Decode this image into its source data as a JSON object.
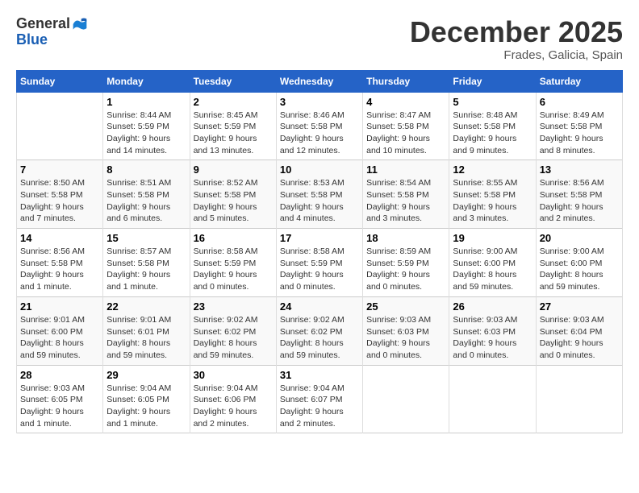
{
  "header": {
    "logo_general": "General",
    "logo_blue": "Blue",
    "month_title": "December 2025",
    "location": "Frades, Galicia, Spain"
  },
  "days_of_week": [
    "Sunday",
    "Monday",
    "Tuesday",
    "Wednesday",
    "Thursday",
    "Friday",
    "Saturday"
  ],
  "weeks": [
    [
      {
        "day": "",
        "info": ""
      },
      {
        "day": "1",
        "info": "Sunrise: 8:44 AM\nSunset: 5:59 PM\nDaylight: 9 hours\nand 14 minutes."
      },
      {
        "day": "2",
        "info": "Sunrise: 8:45 AM\nSunset: 5:59 PM\nDaylight: 9 hours\nand 13 minutes."
      },
      {
        "day": "3",
        "info": "Sunrise: 8:46 AM\nSunset: 5:58 PM\nDaylight: 9 hours\nand 12 minutes."
      },
      {
        "day": "4",
        "info": "Sunrise: 8:47 AM\nSunset: 5:58 PM\nDaylight: 9 hours\nand 10 minutes."
      },
      {
        "day": "5",
        "info": "Sunrise: 8:48 AM\nSunset: 5:58 PM\nDaylight: 9 hours\nand 9 minutes."
      },
      {
        "day": "6",
        "info": "Sunrise: 8:49 AM\nSunset: 5:58 PM\nDaylight: 9 hours\nand 8 minutes."
      }
    ],
    [
      {
        "day": "7",
        "info": "Sunrise: 8:50 AM\nSunset: 5:58 PM\nDaylight: 9 hours\nand 7 minutes."
      },
      {
        "day": "8",
        "info": "Sunrise: 8:51 AM\nSunset: 5:58 PM\nDaylight: 9 hours\nand 6 minutes."
      },
      {
        "day": "9",
        "info": "Sunrise: 8:52 AM\nSunset: 5:58 PM\nDaylight: 9 hours\nand 5 minutes."
      },
      {
        "day": "10",
        "info": "Sunrise: 8:53 AM\nSunset: 5:58 PM\nDaylight: 9 hours\nand 4 minutes."
      },
      {
        "day": "11",
        "info": "Sunrise: 8:54 AM\nSunset: 5:58 PM\nDaylight: 9 hours\nand 3 minutes."
      },
      {
        "day": "12",
        "info": "Sunrise: 8:55 AM\nSunset: 5:58 PM\nDaylight: 9 hours\nand 3 minutes."
      },
      {
        "day": "13",
        "info": "Sunrise: 8:56 AM\nSunset: 5:58 PM\nDaylight: 9 hours\nand 2 minutes."
      }
    ],
    [
      {
        "day": "14",
        "info": "Sunrise: 8:56 AM\nSunset: 5:58 PM\nDaylight: 9 hours\nand 1 minute."
      },
      {
        "day": "15",
        "info": "Sunrise: 8:57 AM\nSunset: 5:58 PM\nDaylight: 9 hours\nand 1 minute."
      },
      {
        "day": "16",
        "info": "Sunrise: 8:58 AM\nSunset: 5:59 PM\nDaylight: 9 hours\nand 0 minutes."
      },
      {
        "day": "17",
        "info": "Sunrise: 8:58 AM\nSunset: 5:59 PM\nDaylight: 9 hours\nand 0 minutes."
      },
      {
        "day": "18",
        "info": "Sunrise: 8:59 AM\nSunset: 5:59 PM\nDaylight: 9 hours\nand 0 minutes."
      },
      {
        "day": "19",
        "info": "Sunrise: 9:00 AM\nSunset: 6:00 PM\nDaylight: 8 hours\nand 59 minutes."
      },
      {
        "day": "20",
        "info": "Sunrise: 9:00 AM\nSunset: 6:00 PM\nDaylight: 8 hours\nand 59 minutes."
      }
    ],
    [
      {
        "day": "21",
        "info": "Sunrise: 9:01 AM\nSunset: 6:00 PM\nDaylight: 8 hours\nand 59 minutes."
      },
      {
        "day": "22",
        "info": "Sunrise: 9:01 AM\nSunset: 6:01 PM\nDaylight: 8 hours\nand 59 minutes."
      },
      {
        "day": "23",
        "info": "Sunrise: 9:02 AM\nSunset: 6:02 PM\nDaylight: 8 hours\nand 59 minutes."
      },
      {
        "day": "24",
        "info": "Sunrise: 9:02 AM\nSunset: 6:02 PM\nDaylight: 8 hours\nand 59 minutes."
      },
      {
        "day": "25",
        "info": "Sunrise: 9:03 AM\nSunset: 6:03 PM\nDaylight: 9 hours\nand 0 minutes."
      },
      {
        "day": "26",
        "info": "Sunrise: 9:03 AM\nSunset: 6:03 PM\nDaylight: 9 hours\nand 0 minutes."
      },
      {
        "day": "27",
        "info": "Sunrise: 9:03 AM\nSunset: 6:04 PM\nDaylight: 9 hours\nand 0 minutes."
      }
    ],
    [
      {
        "day": "28",
        "info": "Sunrise: 9:03 AM\nSunset: 6:05 PM\nDaylight: 9 hours\nand 1 minute."
      },
      {
        "day": "29",
        "info": "Sunrise: 9:04 AM\nSunset: 6:05 PM\nDaylight: 9 hours\nand 1 minute."
      },
      {
        "day": "30",
        "info": "Sunrise: 9:04 AM\nSunset: 6:06 PM\nDaylight: 9 hours\nand 2 minutes."
      },
      {
        "day": "31",
        "info": "Sunrise: 9:04 AM\nSunset: 6:07 PM\nDaylight: 9 hours\nand 2 minutes."
      },
      {
        "day": "",
        "info": ""
      },
      {
        "day": "",
        "info": ""
      },
      {
        "day": "",
        "info": ""
      }
    ]
  ]
}
